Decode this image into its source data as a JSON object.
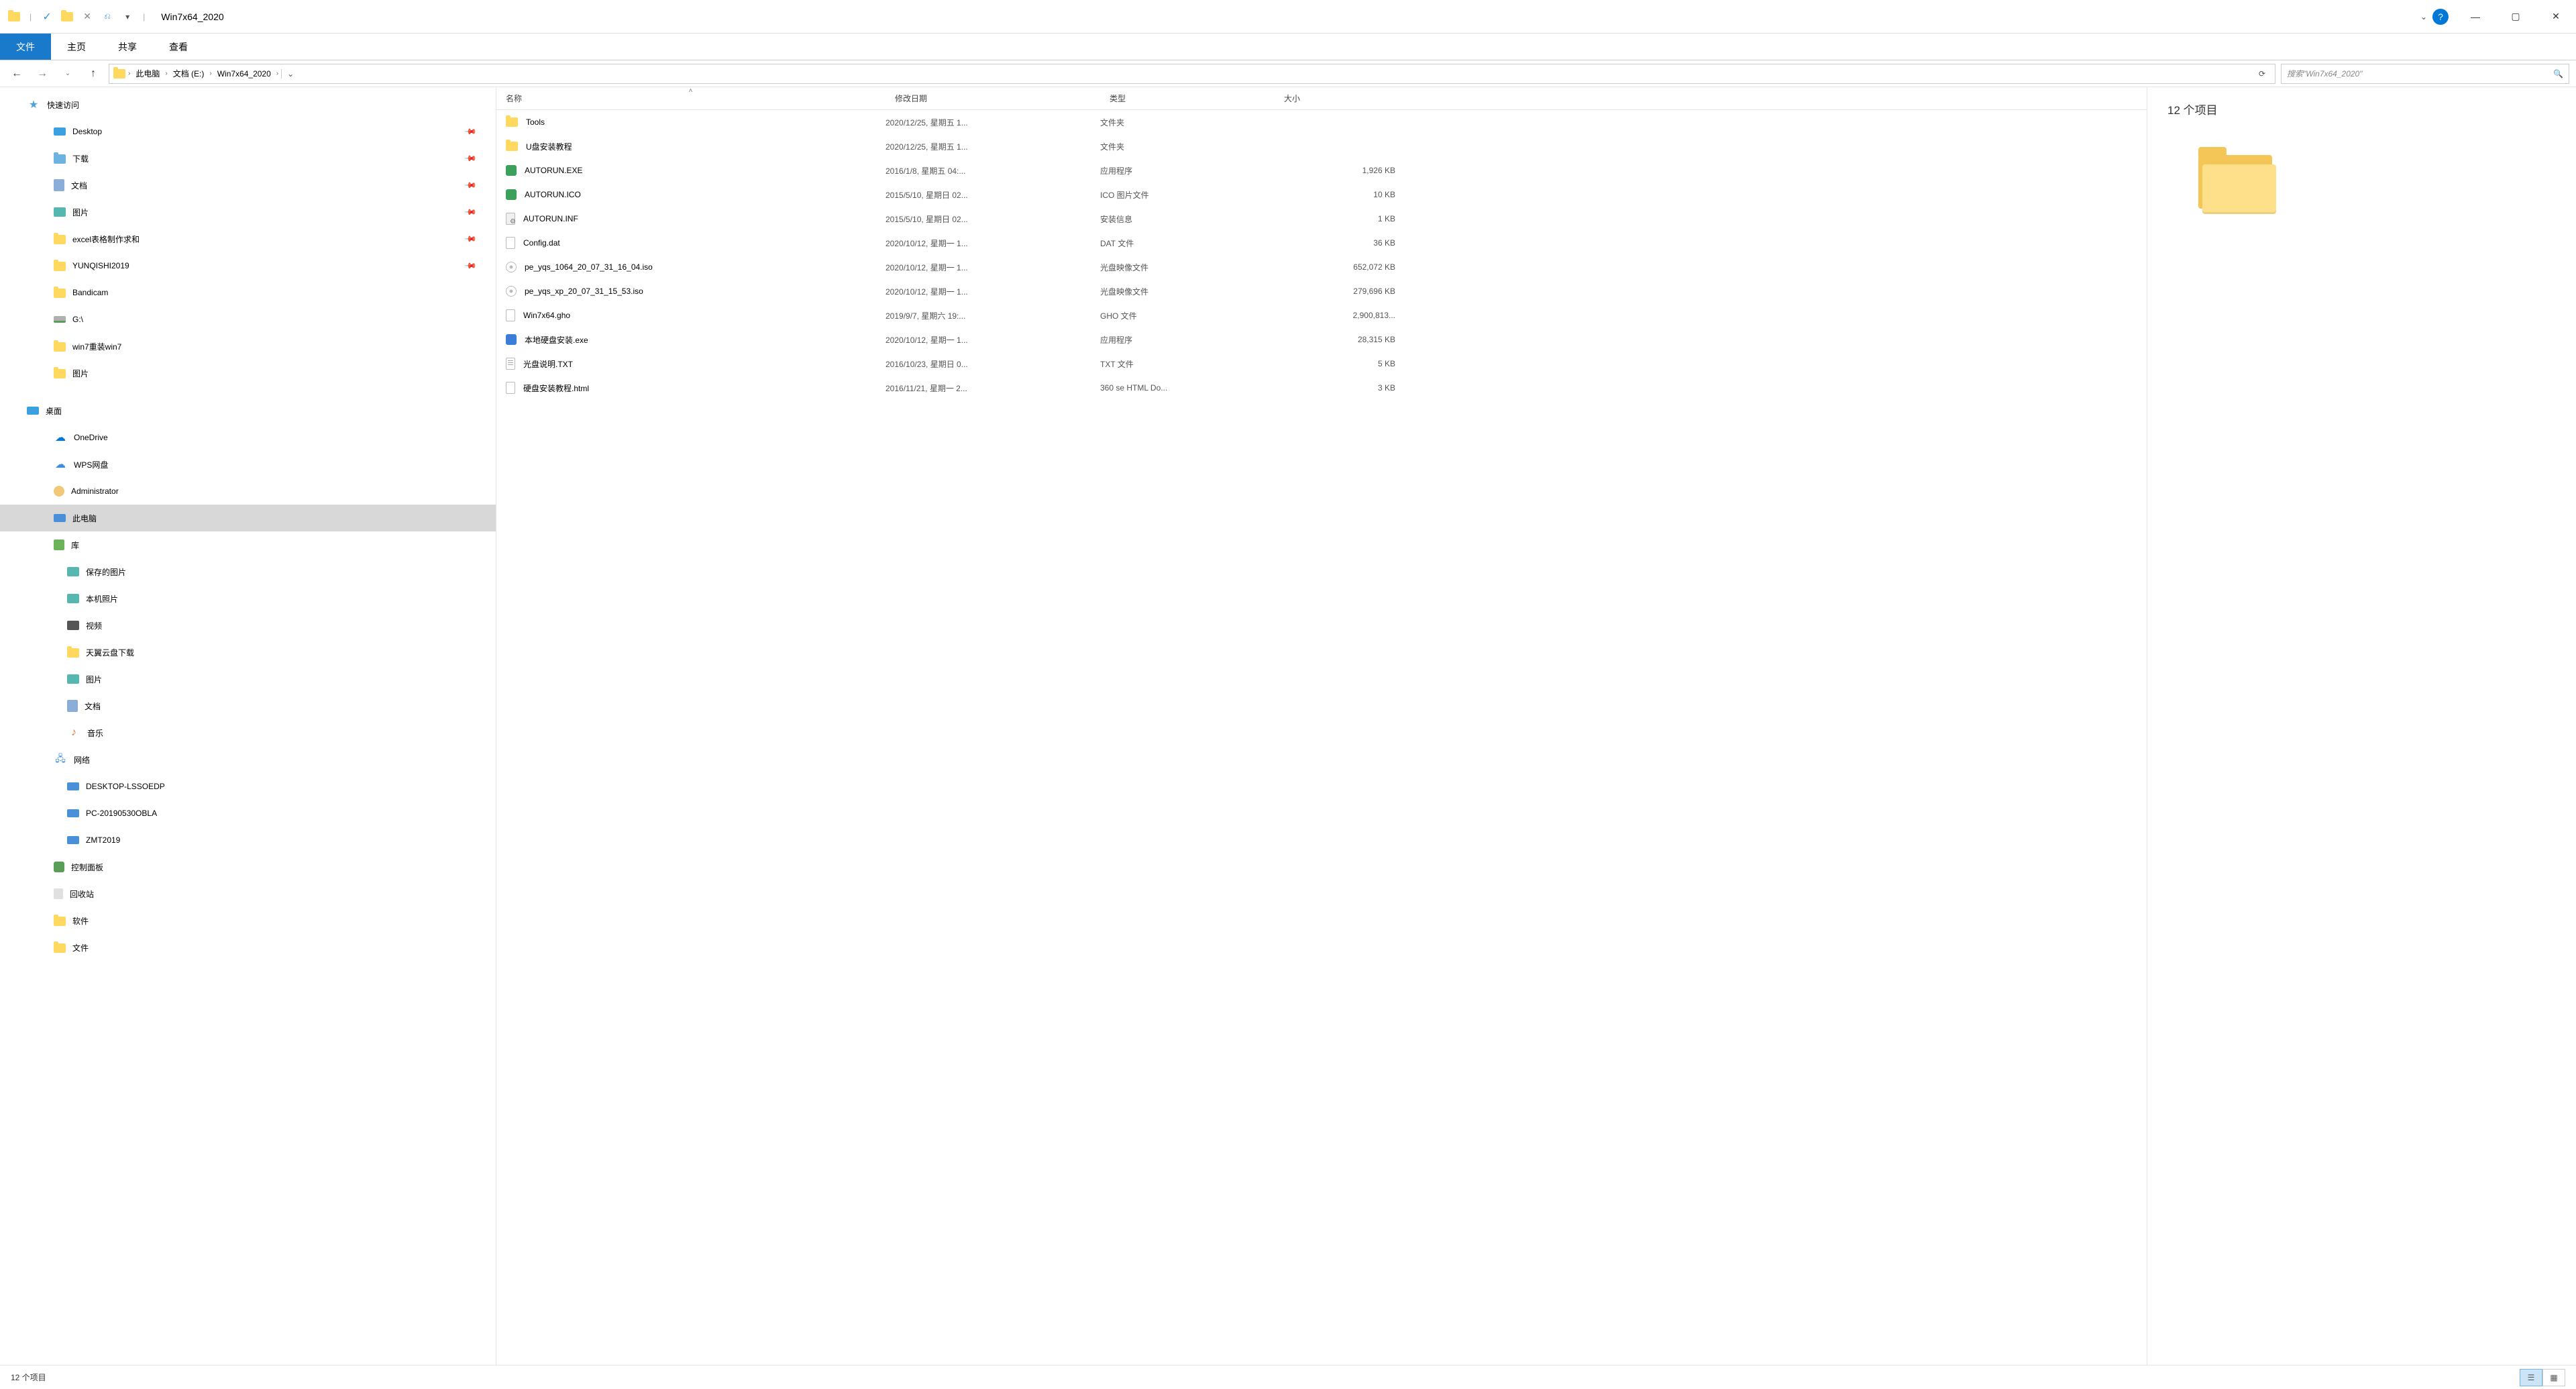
{
  "title": "Win7x64_2020",
  "ribbon": {
    "file": "文件",
    "home": "主页",
    "share": "共享",
    "view": "查看"
  },
  "breadcrumb": [
    "此电脑",
    "文档 (E:)",
    "Win7x64_2020"
  ],
  "search_placeholder": "搜索\"Win7x64_2020\"",
  "columns": {
    "name": "名称",
    "date": "修改日期",
    "type": "类型",
    "size": "大小"
  },
  "tree": {
    "quick_access": "快速访问",
    "qa_items": [
      {
        "label": "Desktop",
        "icon": "desktop",
        "pinned": true
      },
      {
        "label": "下载",
        "icon": "folder.blue",
        "pinned": true
      },
      {
        "label": "文档",
        "icon": "docs",
        "pinned": true
      },
      {
        "label": "图片",
        "icon": "pic",
        "pinned": true
      },
      {
        "label": "excel表格制作求和",
        "icon": "folder",
        "pinned": true
      },
      {
        "label": "YUNQISHI2019",
        "icon": "folder",
        "pinned": true
      },
      {
        "label": "Bandicam",
        "icon": "folder",
        "pinned": false
      },
      {
        "label": "G:\\",
        "icon": "drive",
        "pinned": false
      },
      {
        "label": "win7重装win7",
        "icon": "folder",
        "pinned": false
      },
      {
        "label": "图片",
        "icon": "folder",
        "pinned": false
      }
    ],
    "desktop": "桌面",
    "desktop_items": [
      {
        "label": "OneDrive",
        "icon": "onedrive"
      },
      {
        "label": "WPS网盘",
        "icon": "wps"
      },
      {
        "label": "Administrator",
        "icon": "user"
      },
      {
        "label": "此电脑",
        "icon": "pc",
        "selected": true
      },
      {
        "label": "库",
        "icon": "lib"
      }
    ],
    "lib_items": [
      {
        "label": "保存的图片",
        "icon": "pic"
      },
      {
        "label": "本机照片",
        "icon": "pic"
      },
      {
        "label": "视频",
        "icon": "vid"
      },
      {
        "label": "天翼云盘下载",
        "icon": "folder"
      },
      {
        "label": "图片",
        "icon": "pic"
      },
      {
        "label": "文档",
        "icon": "docs"
      },
      {
        "label": "音乐",
        "icon": "music"
      }
    ],
    "network": "网络",
    "net_items": [
      {
        "label": "DESKTOP-LSSOEDP",
        "icon": "pc"
      },
      {
        "label": "PC-20190530OBLA",
        "icon": "pc"
      },
      {
        "label": "ZMT2019",
        "icon": "pc"
      }
    ],
    "control_panel": "控制面板",
    "recycle_bin": "回收站",
    "software": "软件",
    "files_folder": "文件"
  },
  "files": [
    {
      "name": "Tools",
      "date": "2020/12/25, 星期五 1...",
      "type": "文件夹",
      "size": "",
      "icon": "folder"
    },
    {
      "name": "U盘安装教程",
      "date": "2020/12/25, 星期五 1...",
      "type": "文件夹",
      "size": "",
      "icon": "folder"
    },
    {
      "name": "AUTORUN.EXE",
      "date": "2016/1/8, 星期五 04:...",
      "type": "应用程序",
      "size": "1,926 KB",
      "icon": "exe"
    },
    {
      "name": "AUTORUN.ICO",
      "date": "2015/5/10, 星期日 02...",
      "type": "ICO 图片文件",
      "size": "10 KB",
      "icon": "ico"
    },
    {
      "name": "AUTORUN.INF",
      "date": "2015/5/10, 星期日 02...",
      "type": "安装信息",
      "size": "1 KB",
      "icon": "inf"
    },
    {
      "name": "Config.dat",
      "date": "2020/10/12, 星期一 1...",
      "type": "DAT 文件",
      "size": "36 KB",
      "icon": "file"
    },
    {
      "name": "pe_yqs_1064_20_07_31_16_04.iso",
      "date": "2020/10/12, 星期一 1...",
      "type": "光盘映像文件",
      "size": "652,072 KB",
      "icon": "iso"
    },
    {
      "name": "pe_yqs_xp_20_07_31_15_53.iso",
      "date": "2020/10/12, 星期一 1...",
      "type": "光盘映像文件",
      "size": "279,696 KB",
      "icon": "iso"
    },
    {
      "name": "Win7x64.gho",
      "date": "2019/9/7, 星期六 19:...",
      "type": "GHO 文件",
      "size": "2,900,813...",
      "icon": "gho"
    },
    {
      "name": "本地硬盘安装.exe",
      "date": "2020/10/12, 星期一 1...",
      "type": "应用程序",
      "size": "28,315 KB",
      "icon": "exe2"
    },
    {
      "name": "光盘说明.TXT",
      "date": "2016/10/23, 星期日 0...",
      "type": "TXT 文件",
      "size": "5 KB",
      "icon": "txt"
    },
    {
      "name": "硬盘安装教程.html",
      "date": "2016/11/21, 星期一 2...",
      "type": "360 se HTML Do...",
      "size": "3 KB",
      "icon": "html"
    }
  ],
  "preview": {
    "count": "12 个项目"
  },
  "status": {
    "items": "12 个项目"
  }
}
